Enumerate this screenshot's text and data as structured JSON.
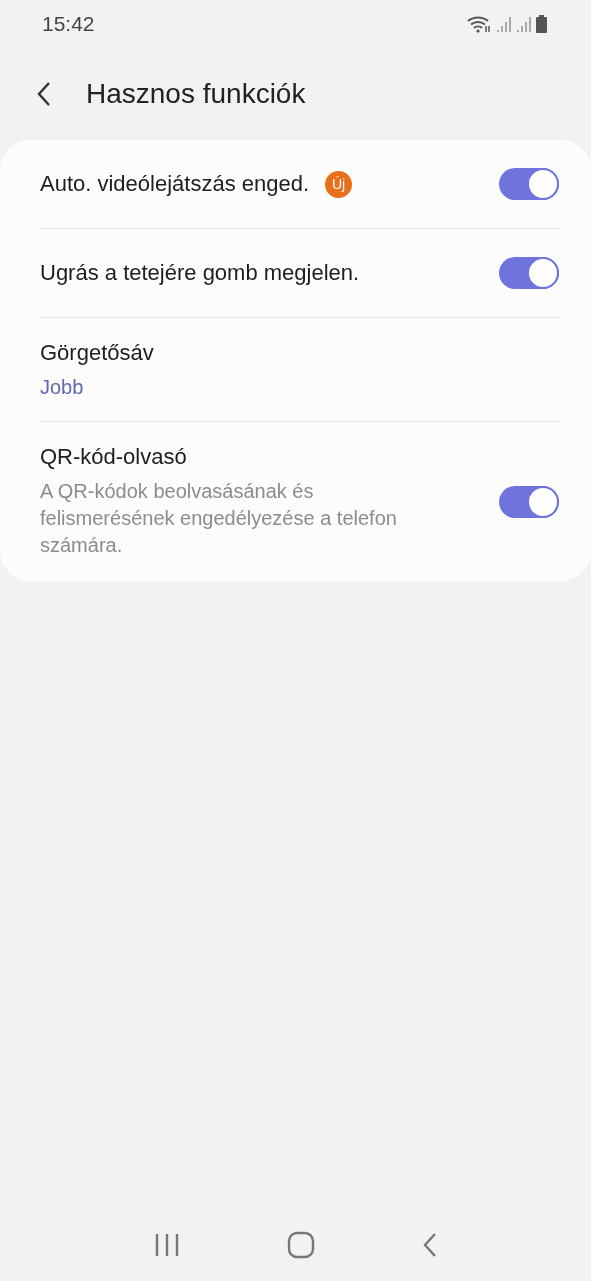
{
  "status_bar": {
    "time": "15:42"
  },
  "header": {
    "title": "Hasznos funkciók"
  },
  "items": [
    {
      "kind": "toggle",
      "title": "Auto. videólejátszás enged.",
      "badge": "Új",
      "on": true
    },
    {
      "kind": "toggle",
      "title": "Ugrás a tetejére gomb megjelen.",
      "on": true
    },
    {
      "kind": "value",
      "title": "Görgetősáv",
      "value": "Jobb"
    },
    {
      "kind": "toggle",
      "title": "QR-kód-olvasó",
      "description": "A QR-kódok beolvasásának és felismerésének engedélyezése a telefon számára.",
      "on": true
    }
  ]
}
